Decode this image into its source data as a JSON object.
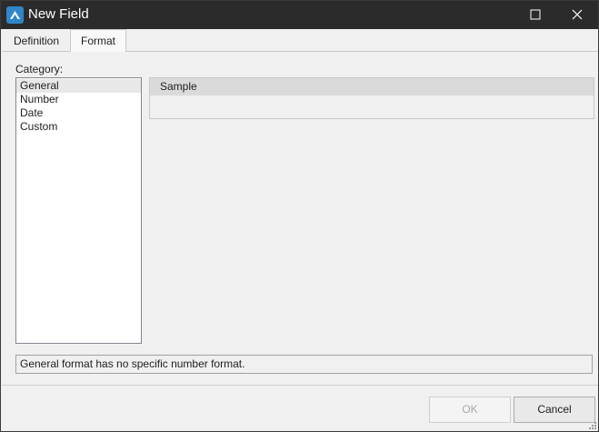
{
  "window": {
    "title": "New Field",
    "app_icon": "app-logo-icon",
    "controls": [
      "maximize-icon",
      "close-icon"
    ]
  },
  "tabs": [
    {
      "label": "Definition",
      "active": false
    },
    {
      "label": "Format",
      "active": true
    }
  ],
  "category": {
    "label": "Category:",
    "items": [
      "General",
      "Number",
      "Date",
      "Custom"
    ],
    "selected": "General"
  },
  "sample": {
    "header": "Sample",
    "value": ""
  },
  "description": "General format has no specific number format.",
  "buttons": {
    "ok_label": "OK",
    "ok_enabled": false,
    "cancel_label": "Cancel"
  },
  "colors": {
    "titlebar": "#2b2b2b",
    "app_icon": "#2f86c8",
    "dialog_bg": "#f0f0f0"
  }
}
